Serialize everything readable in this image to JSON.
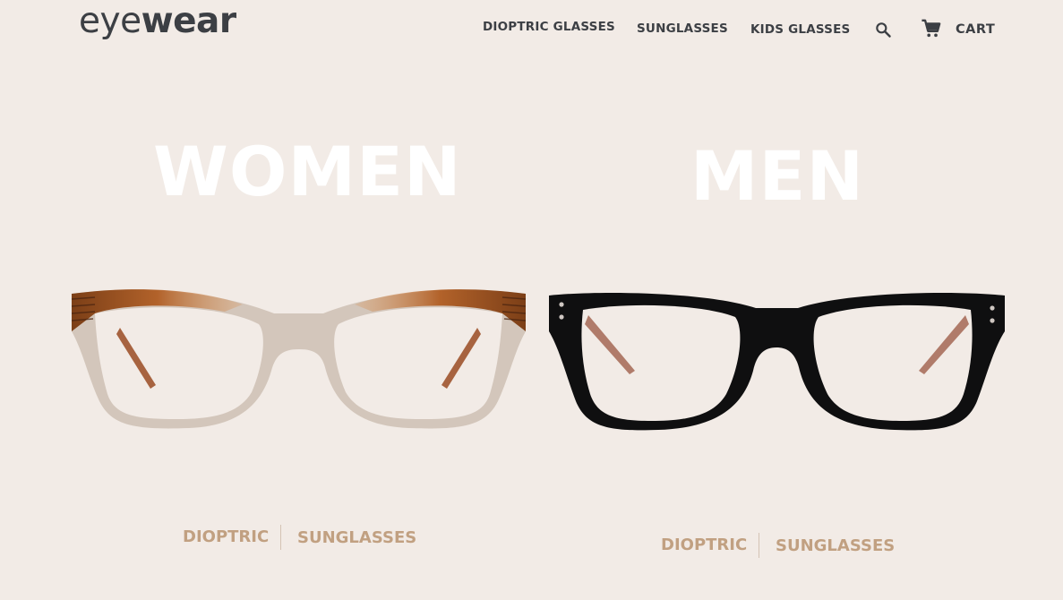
{
  "header": {
    "logo_light": "eye",
    "logo_bold": "wear",
    "nav": [
      "DIOPTRIC GLASSES",
      "SUNGLASSES",
      "KIDS GLASSES"
    ],
    "cart_label": "CART"
  },
  "sections": {
    "women": {
      "title": "WOMEN",
      "link_dioptric": "DIOPTRIC",
      "link_sunglasses": "SUNGLASSES"
    },
    "men": {
      "title": "MEN",
      "link_dioptric": "DIOPTRIC",
      "link_sunglasses": "SUNGLASSES"
    }
  },
  "icons": {
    "search": "search-icon",
    "cart": "cart-icon"
  },
  "colors": {
    "background": "#f2ebe6",
    "text": "#3c3f44",
    "accent": "#c1a081",
    "hero_title": "#ffffff"
  }
}
